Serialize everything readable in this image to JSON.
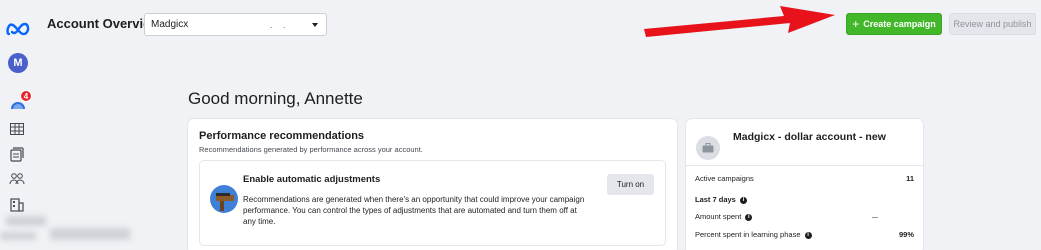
{
  "header": {
    "title": "Account Overview",
    "account_select": {
      "value": "Madgicx",
      "extra": ". ."
    },
    "create_campaign": "Create campaign",
    "review_publish": "Review and publish"
  },
  "sidebar": {
    "avatar_letter": "M",
    "notification_count": "4",
    "icons": [
      "meta-logo",
      "account-avatar",
      "campaigns-icon",
      "grid-icon",
      "pages-icon",
      "audience-icon",
      "building-icon"
    ]
  },
  "greeting": "Good morning, Annette",
  "performance": {
    "title": "Performance recommendations",
    "subtitle": "Recommendations generated by performance across your account.",
    "recommendation": {
      "title": "Enable automatic adjustments",
      "description": "Recommendations are generated when there's an opportunity that could improve your campaign performance. You can control the types of adjustments that are automated and turn them off at any time.",
      "button": "Turn on"
    }
  },
  "account_card": {
    "name": "Madgicx - dollar account - new",
    "rows": [
      {
        "label": "Active campaigns",
        "value": "11"
      },
      {
        "label": "Last 7 days",
        "value": ""
      },
      {
        "label": "Amount spent",
        "value": ""
      },
      {
        "label": "Percent spent in learning phase",
        "value": "99%"
      }
    ]
  },
  "colors": {
    "create_green": "#42b72a",
    "arrow_red": "#e8121a",
    "badge_red": "#e4262c",
    "avatar_blue": "#4a5fc9",
    "meta_blue": "#0866ff"
  }
}
